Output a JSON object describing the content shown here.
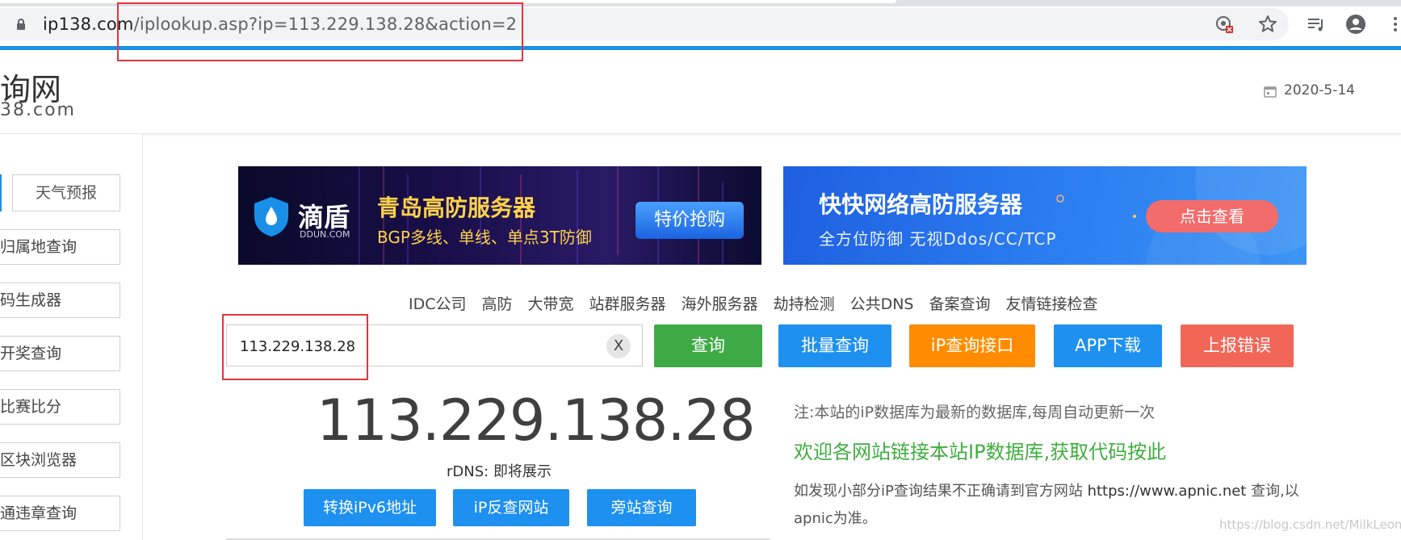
{
  "browser": {
    "url_host": "ip138.com",
    "url_path": "/iplookup.asp?ip=113.229.138.28&action=2",
    "icons": [
      "lock-icon",
      "tracking-blocked-icon",
      "star-icon",
      "reading-list-icon",
      "account-icon",
      "more-icon"
    ]
  },
  "site": {
    "logo_cn": "询网",
    "logo_en": "38.com",
    "date": "2020-5-14"
  },
  "sidebar": {
    "weather": "天气预报",
    "items": [
      "归属地查询",
      "码生成器",
      "开奖查询",
      "比赛比分",
      "区块浏览器",
      "通违章查询"
    ]
  },
  "banners": {
    "b1": {
      "brand_cn": "滴盾",
      "brand_en": "DDUN.COM",
      "title": "青岛高防服务器",
      "sub": "BGP多线、单线、单点3T防御",
      "cta": "特价抢购"
    },
    "b2": {
      "title": "快快网络高防服务器",
      "sub": "全方位防御  无视Ddos/CC/TCP",
      "cta": "点击查看"
    }
  },
  "nav": [
    "IDC公司",
    "高防",
    "大带宽",
    "站群服务器",
    "海外服务器",
    "劫持检测",
    "公共DNS",
    "备案查询",
    "友情链接检查"
  ],
  "search": {
    "value": "113.229.138.28",
    "clear": "X",
    "buttons": [
      {
        "label": "查询",
        "color": "#3eaa46"
      },
      {
        "label": "批量查询",
        "color": "#1e90f0"
      },
      {
        "label": "iP查询接口",
        "color": "#ff8c00"
      },
      {
        "label": "APP下载",
        "color": "#1e90f0"
      },
      {
        "label": "上报错误",
        "color": "#f26658"
      }
    ]
  },
  "result": {
    "ip": "113.229.138.28",
    "rdns": "rDNS: 即将展示",
    "actions": [
      "转换iPv6地址",
      "iP反查网站",
      "旁站查询"
    ]
  },
  "notes": {
    "n1": "注:本站的iP数据库为最新的数据库,每周自动更新一次",
    "n2": "欢迎各网站链接本站IP数据库,获取代码按此",
    "n3a": "如发现小部分iP查询结果不正确请到官方网站 ",
    "n3link": "https://www.apnic.net",
    "n3b": " 查询,以apnic为准。"
  },
  "watermark": "https://blog.csdn.net/MilkLeong"
}
